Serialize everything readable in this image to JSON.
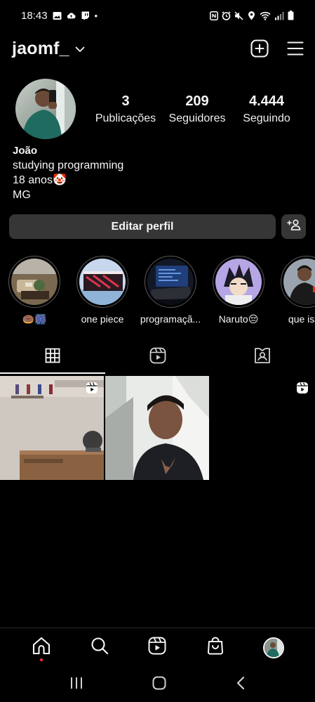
{
  "status": {
    "time": "18:43",
    "dot": "•",
    "left_icons": [
      "image-icon",
      "cloud-upload-icon",
      "twitch-icon"
    ],
    "right_icons": [
      "nfc-icon",
      "alarm-icon",
      "mute-icon",
      "location-icon",
      "wifi-icon",
      "signal-icon",
      "battery-icon"
    ]
  },
  "header": {
    "username": "jaomf_",
    "chevron_icon": "chevron-down-icon",
    "new_post_icon": "plus-square-icon",
    "menu_icon": "hamburger-menu-icon"
  },
  "profile": {
    "stats": [
      {
        "value": "3",
        "label": "Publicações"
      },
      {
        "value": "209",
        "label": "Seguidores"
      },
      {
        "value": "4.444",
        "label": "Seguindo"
      }
    ],
    "name": "João",
    "bio": [
      "studying programming",
      "18 anos🤡",
      "MG"
    ]
  },
  "actions": {
    "edit_profile": "Editar perfil",
    "discover_icon": "add-person-icon"
  },
  "highlights": [
    {
      "label": "🍩🎆"
    },
    {
      "label": "one piece"
    },
    {
      "label": "programaçã..."
    },
    {
      "label": "Naruto😔"
    },
    {
      "label": "que isso"
    }
  ],
  "tabs": [
    {
      "icon": "grid-icon",
      "active": true
    },
    {
      "icon": "reels-icon",
      "active": false
    },
    {
      "icon": "tagged-icon",
      "active": false
    }
  ],
  "posts": [
    {
      "type": "reel",
      "icon": "reel-badge-icon"
    },
    {
      "type": "photo"
    },
    {
      "type": "reel",
      "icon": "reel-badge-icon"
    }
  ],
  "bottom_nav": [
    "home-icon",
    "search-icon",
    "reels-icon",
    "shop-icon",
    "profile-avatar"
  ],
  "system_nav": [
    "recent-apps-icon",
    "home-button-icon",
    "back-icon"
  ],
  "colors": {
    "background": "#000000",
    "button": "#363636",
    "text": "#f5f5f5",
    "notification_dot": "#ff3040"
  }
}
